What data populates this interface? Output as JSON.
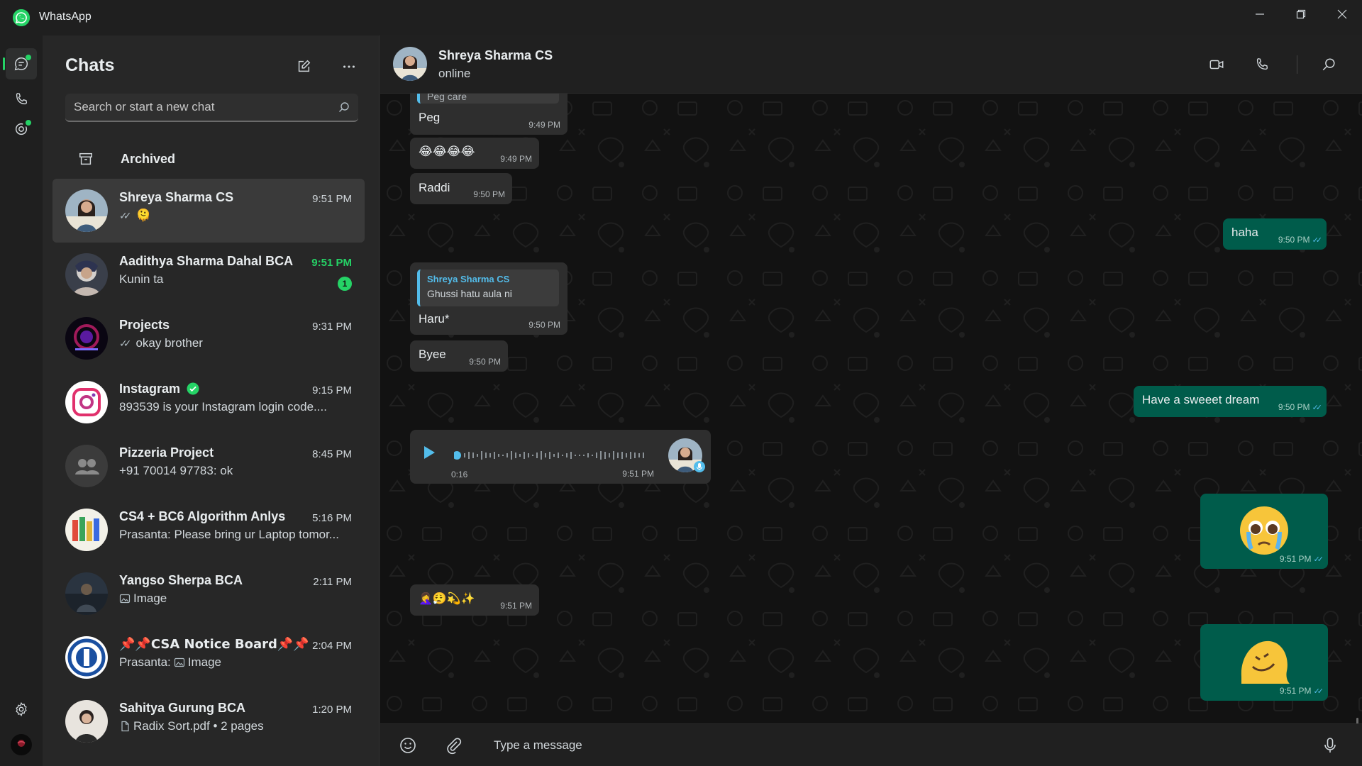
{
  "window": {
    "app_title": "WhatsApp"
  },
  "sidebar": {
    "title": "Chats",
    "search_placeholder": "Search or start a new chat",
    "archived_label": "Archived"
  },
  "chats": [
    {
      "name": "Shreya Sharma CS",
      "time": "9:51 PM",
      "preview": "🫠",
      "read_ticks": "✓✓",
      "selected": true
    },
    {
      "name": "Aadithya Sharma Dahal BCA",
      "time": "9:51 PM",
      "preview": "Kunin ta",
      "unread_count": "1"
    },
    {
      "name": "Projects",
      "time": "9:31 PM",
      "preview": "okay brother",
      "read_ticks": "✓✓"
    },
    {
      "name": "Instagram",
      "time": "9:15 PM",
      "preview": "893539 is your Instagram login code...."
    },
    {
      "name": "Pizzeria Project",
      "time": "8:45 PM",
      "preview": "+91 70014 97783: ok"
    },
    {
      "name": "CS4 + BC6 Algorithm Anlys",
      "time": "5:16 PM",
      "preview": "Prasanta: Please bring ur Laptop tomor..."
    },
    {
      "name": "Yangso Sherpa BCA",
      "time": "2:11 PM",
      "preview": "Image"
    },
    {
      "name": "📌📌CSA Notice Board📌📌",
      "time": "2:04 PM",
      "preview_prefix": "Prasanta:",
      "preview": "Image"
    },
    {
      "name": "Sahitya Gurung BCA",
      "time": "1:20 PM",
      "preview": "Radix Sort.pdf • 2 pages"
    }
  ],
  "conversation": {
    "contact_name": "Shreya Sharma CS",
    "status": "online",
    "composer_placeholder": "Type a message",
    "messages": [
      {
        "dir": "in",
        "quote_partial": "Peg care",
        "text": "Peg",
        "time": "9:49 PM"
      },
      {
        "dir": "in",
        "text": "😂😂😂😂",
        "time": "9:49 PM"
      },
      {
        "dir": "in",
        "text": "Raddi",
        "time": "9:50 PM"
      },
      {
        "dir": "out",
        "text": "haha",
        "time": "9:50 PM"
      },
      {
        "dir": "in",
        "quote_name": "Shreya Sharma CS",
        "quote_text": "Ghussi hatu aula ni",
        "text": "Haru*",
        "time": "9:50 PM"
      },
      {
        "dir": "in",
        "text": "Byee",
        "time": "9:50 PM"
      },
      {
        "dir": "out",
        "text": "Have a sweeet dream",
        "time": "9:50 PM"
      },
      {
        "dir": "in",
        "type": "voice",
        "duration": "0:16",
        "time": "9:51 PM"
      },
      {
        "dir": "out",
        "type": "sticker",
        "sticker": "pleading-tears-emoji",
        "time": "9:51 PM"
      },
      {
        "dir": "in",
        "text": "🤦‍♀️😮‍💨💫✨",
        "time": "9:51 PM"
      },
      {
        "dir": "out",
        "type": "sticker",
        "sticker": "melting-face-emoji",
        "time": "9:51 PM"
      }
    ]
  },
  "colors": {
    "accent": "#25d366",
    "outgoing_bubble": "#005c4b",
    "incoming_bubble": "#2e2e2e",
    "read_tick": "#53bdeb"
  }
}
